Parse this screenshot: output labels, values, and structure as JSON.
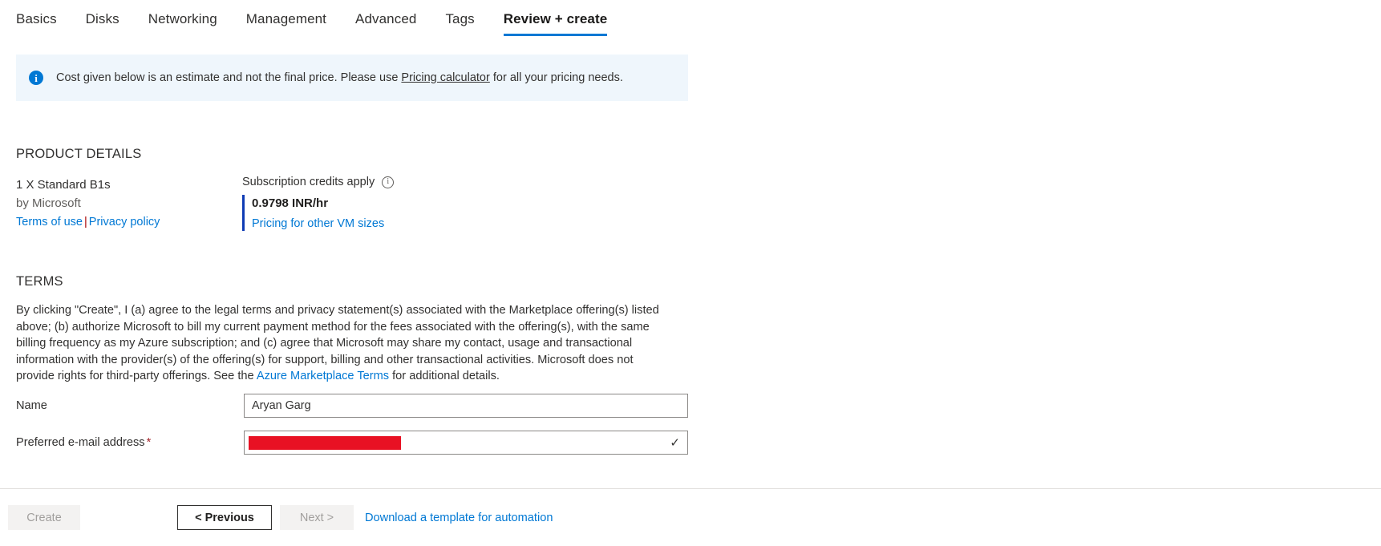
{
  "tabs": [
    {
      "label": "Basics",
      "active": false
    },
    {
      "label": "Disks",
      "active": false
    },
    {
      "label": "Networking",
      "active": false
    },
    {
      "label": "Management",
      "active": false
    },
    {
      "label": "Advanced",
      "active": false
    },
    {
      "label": "Tags",
      "active": false
    },
    {
      "label": "Review + create",
      "active": true
    }
  ],
  "banner": {
    "icon": "info-icon",
    "text_before": "Cost given below is an estimate and not the final price. Please use ",
    "link_label": "Pricing calculator",
    "text_after": " for all your pricing needs."
  },
  "product_details": {
    "section_title": "PRODUCT DETAILS",
    "name": "1 X Standard B1s",
    "publisher": "by Microsoft",
    "terms_of_use_label": "Terms of use",
    "separator": "|",
    "privacy_policy_label": "Privacy policy",
    "credits_label": "Subscription credits apply",
    "credits_info_icon": "info-icon",
    "price": "0.9798 INR/hr",
    "pricing_link_label": "Pricing for other VM sizes"
  },
  "terms": {
    "section_title": "TERMS",
    "paragraph_part1": "By clicking \"Create\", I (a) agree to the legal terms and privacy statement(s) associated with the Marketplace offering(s) listed above; (b) authorize Microsoft to bill my current payment method for the fees associated with the offering(s), with the same billing frequency as my Azure subscription; and (c) agree that Microsoft may share my contact, usage and transactional information with the provider(s) of the offering(s) for support, billing and other transactional activities. Microsoft does not provide rights for third-party offerings. See the ",
    "link_label": "Azure Marketplace Terms",
    "paragraph_part2": " for additional details."
  },
  "form": {
    "name_label": "Name",
    "name_value": "Aryan Garg",
    "email_label": "Preferred e-mail address",
    "email_required_marker": "*",
    "email_value": "",
    "email_redacted": true,
    "email_valid_icon": "checkmark-icon"
  },
  "footer": {
    "create_label": "Create",
    "previous_label": "< Previous",
    "next_label": "Next >",
    "download_template_label": "Download a template for automation"
  },
  "colors": {
    "accent": "#0078d4",
    "banner_bg": "#eff6fc",
    "price_border": "#0f3bb5",
    "required_star": "#a4262c",
    "redaction": "#e81123"
  }
}
